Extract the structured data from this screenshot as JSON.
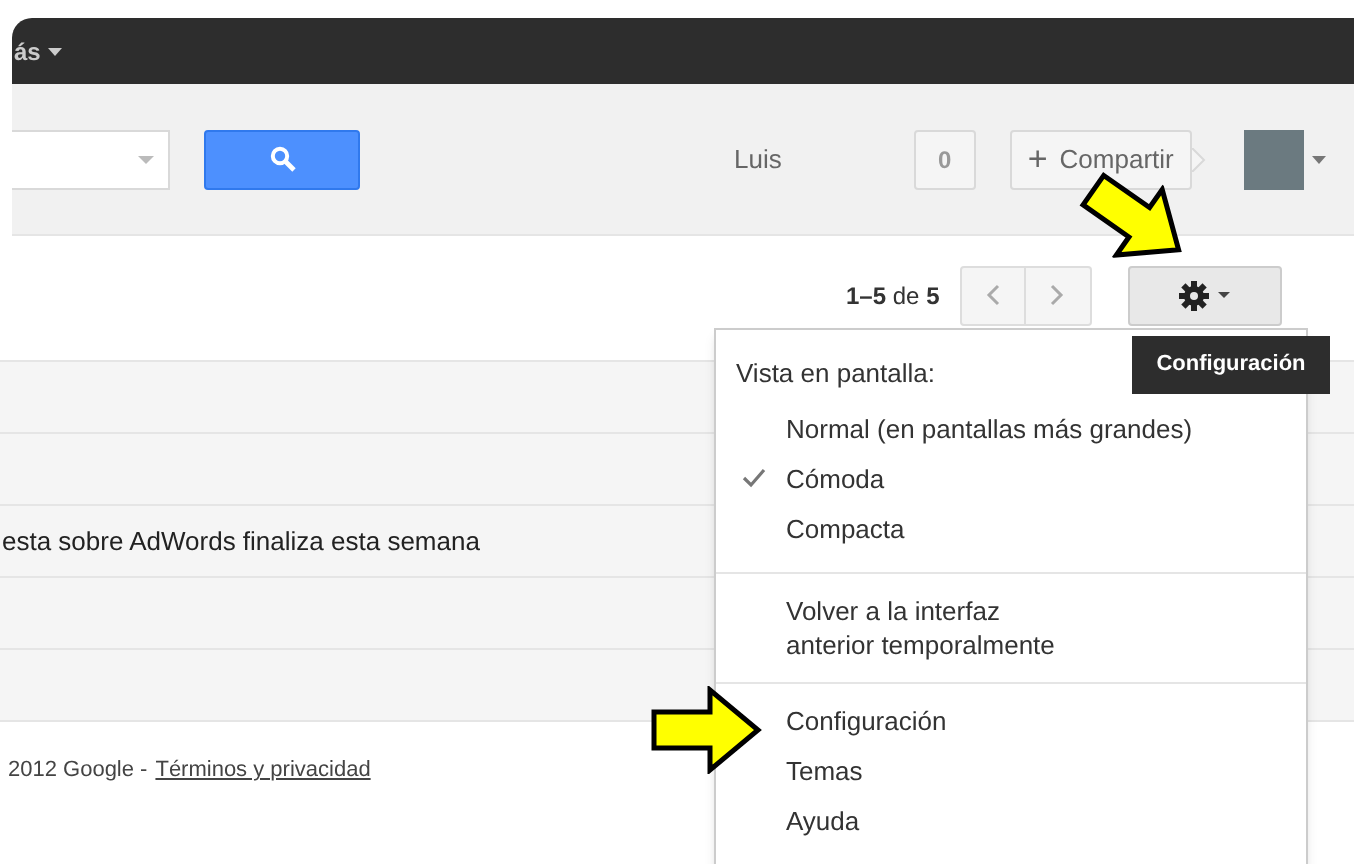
{
  "topbar": {
    "menu_label": "ás"
  },
  "header": {
    "user_name": "Luis",
    "notification_count": "0",
    "share_button": "Compartir",
    "share_plus": "+"
  },
  "toolbar": {
    "page_range": "1–5",
    "page_of": "de",
    "page_total": "5"
  },
  "tooltip": "Configuración",
  "messages": [
    {
      "kind": "blank"
    },
    {
      "kind": "blank"
    },
    {
      "kind": "text",
      "subject": "esta sobre AdWords finaliza esta semana"
    },
    {
      "kind": "blank"
    },
    {
      "kind": "blank"
    }
  ],
  "footer": {
    "copyright": "2012 Google -",
    "link": "Términos y privacidad"
  },
  "settings_menu": {
    "sections": [
      {
        "heading": "Vista en pantalla:",
        "items": [
          {
            "label": "Normal (en pantallas más grandes)",
            "selected": false
          },
          {
            "label": "Cómoda",
            "selected": true
          },
          {
            "label": "Compacta",
            "selected": false
          }
        ]
      },
      {
        "items": [
          {
            "label": "Volver a la interfaz\nanterior temporalmente"
          }
        ]
      },
      {
        "items": [
          {
            "label": "Configuración"
          },
          {
            "label": "Temas"
          },
          {
            "label": "Ayuda"
          }
        ]
      }
    ]
  }
}
